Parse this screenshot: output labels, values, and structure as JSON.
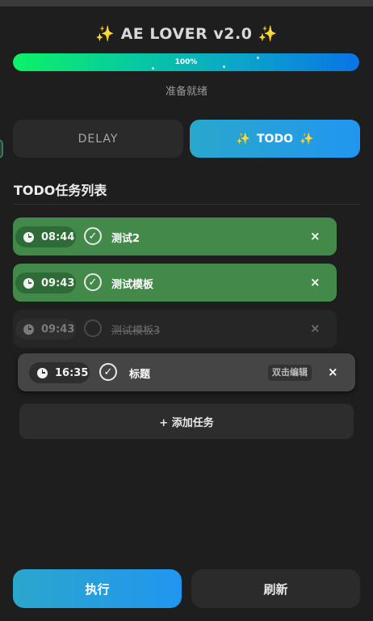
{
  "header": {
    "title": "AE LOVER v2.0",
    "sparkle": "✨"
  },
  "progress": {
    "value": 1.0,
    "label": "100%",
    "colors": [
      "#0cf267",
      "#0a73e6"
    ]
  },
  "status_text": "准备就绪",
  "tabs": [
    {
      "label": "DELAY",
      "active": false
    },
    {
      "label": "TODO",
      "active": true
    }
  ],
  "section_title": "TODO任务列表",
  "tasks": [
    {
      "time": "08:44",
      "label": "测试2",
      "done": true,
      "close": "×"
    },
    {
      "time": "09:43",
      "label": "测试模板",
      "done": true,
      "close": "×"
    },
    {
      "time": "09:43",
      "label": "测试模板3",
      "done": false,
      "close": "×"
    },
    {
      "time": "16:35",
      "label": "标题",
      "done": true,
      "edit_hint": "双击编辑",
      "close": "×"
    }
  ],
  "check_glyph": "✓",
  "add_task_label": "+ 添加任务",
  "actions": {
    "run_label": "执行",
    "refresh_label": "刷新"
  },
  "colors": {
    "accent": "#2196f0",
    "done": "#43894a",
    "background": "#1e1e1e"
  }
}
